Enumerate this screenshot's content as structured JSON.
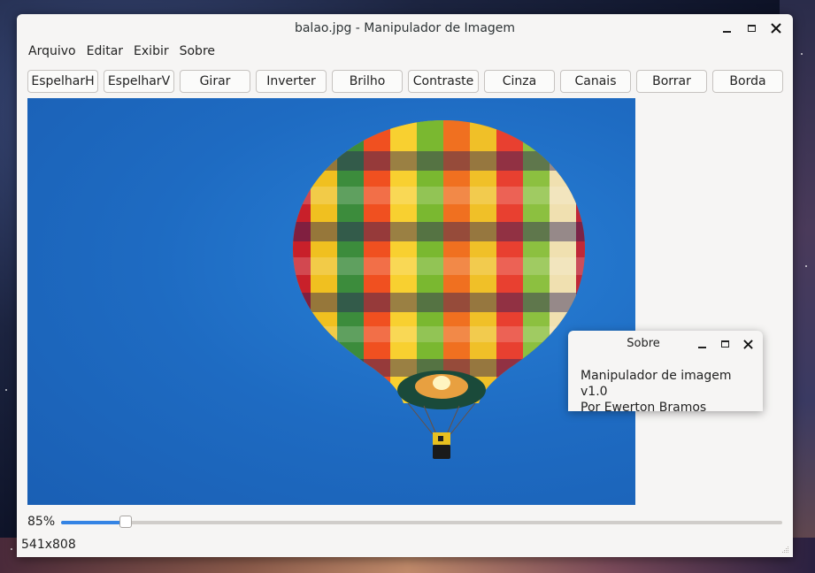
{
  "window": {
    "title": "balao.jpg - Manipulador de Imagem"
  },
  "menu": [
    "Arquivo",
    "Editar",
    "Exibir",
    "Sobre"
  ],
  "toolbar": [
    "EspelharH",
    "EspelharV",
    "Girar",
    "Inverter",
    "Brilho",
    "Contraste",
    "Cinza",
    "Canais",
    "Borrar",
    "Borda"
  ],
  "zoom": {
    "label": "85%",
    "slider_fraction": 0.09
  },
  "status": {
    "dimensions": "541x808"
  },
  "about_dialog": {
    "title": "Sobre",
    "line1": "Manipulador de imagem v1.0",
    "line2": "Por Ewerton Bramos"
  },
  "image": {
    "subject": "hot-air-balloon",
    "sky_color": "#1e6bc2"
  },
  "colors": {
    "accent": "#3584e4",
    "window_bg": "#f6f5f4"
  }
}
